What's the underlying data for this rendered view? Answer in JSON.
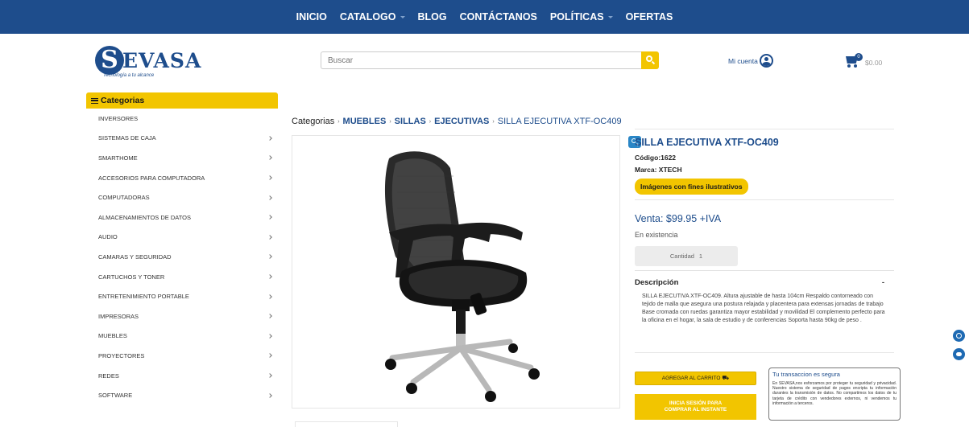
{
  "nav": {
    "items": [
      {
        "label": "INICIO",
        "dropdown": false
      },
      {
        "label": "CATALOGO",
        "dropdown": true
      },
      {
        "label": "BLOG",
        "dropdown": false
      },
      {
        "label": "CONTÁCTANOS",
        "dropdown": false
      },
      {
        "label": "POLÍTICAS",
        "dropdown": true
      },
      {
        "label": "OFERTAS",
        "dropdown": false
      }
    ]
  },
  "logo": {
    "initial": "S",
    "word": "EVASA",
    "tagline": "Tecnología a tu alcance"
  },
  "search": {
    "placeholder": "Buscar",
    "icon": "search-icon"
  },
  "account": {
    "label": "Mi cuenta",
    "icon": "user-icon"
  },
  "cart": {
    "count": "0",
    "total": "$0.00",
    "icon": "cart-icon"
  },
  "sidebar": {
    "heading": "Categorias",
    "items": [
      {
        "label": "INVERSORES",
        "has_children": false
      },
      {
        "label": "SISTEMAS DE CAJA",
        "has_children": true
      },
      {
        "label": "SMARTHOME",
        "has_children": true
      },
      {
        "label": "ACCESORIOS PARA COMPUTADORA",
        "has_children": true
      },
      {
        "label": "COMPUTADORAS",
        "has_children": true
      },
      {
        "label": "ALMACENAMIENTOS DE DATOS",
        "has_children": true
      },
      {
        "label": "AUDIO",
        "has_children": true
      },
      {
        "label": "CAMARAS Y SEGURIDAD",
        "has_children": true
      },
      {
        "label": "CARTUCHOS Y TONER",
        "has_children": true
      },
      {
        "label": "ENTRETENIMIENTO PORTABLE",
        "has_children": true
      },
      {
        "label": "IMPRESORAS",
        "has_children": true
      },
      {
        "label": "MUEBLES",
        "has_children": true
      },
      {
        "label": "PROYECTORES",
        "has_children": true
      },
      {
        "label": "REDES",
        "has_children": true
      },
      {
        "label": "SOFTWARE",
        "has_children": true
      }
    ]
  },
  "breadcrumb": {
    "root": "Categorias",
    "links": [
      "MUEBLES",
      "SILLAS",
      "EJECUTIVAS"
    ],
    "current": "SILLA EJECUTIVA XTF-OC409"
  },
  "product": {
    "title": "SILLA EJECUTIVA XTF-OC409",
    "code_label": "Código:",
    "code": "1622",
    "brand_label": "Marca:",
    "brand": "XTECH",
    "illustrative_badge": "Imágenes con fines ilustrativos",
    "price": "Venta: $99.95 +IVA",
    "stock": "En existencia",
    "quantity_label": "Cantidad",
    "quantity_value": "1",
    "description_heading": "Descripción",
    "description_toggle": "-",
    "description": "SILLA EJECUTIVA XTF-OC409. Altura ajustable de hasta 104cm Respaldo contorneado con tejido de malla que asegura una postura relajada y placentera para extensas jornadas de trabajo Base cromada con ruedas garantiza mayor estabilidad y movilidad El complemento perfecto para la oficina en el hogar, la sala de estudio y de conferencias Soporta hasta 90kg de peso ."
  },
  "actions": {
    "add_to_cart": "AGREGAR AL CARRITO ",
    "login_line1": "INICIA SESIÓN PARA",
    "login_line2": "COMPRAR AL INSTANTE"
  },
  "secure": {
    "title": "Tu transaccion es segura",
    "body": "En SEVASA,nos esforzamos por proteger tu seguridad y privacidad. Nuestro sistema de seguridad de pagos encripta tu información durantes la transmisión de datos. No compartimos los datos de tu tarjeta de crédito con vendedores externos, ni vendemos tu información a terceros."
  },
  "colors": {
    "brand_blue": "#1e4d8c",
    "accent_yellow": "#f2c500",
    "float_blue": "#1e6ab3"
  }
}
